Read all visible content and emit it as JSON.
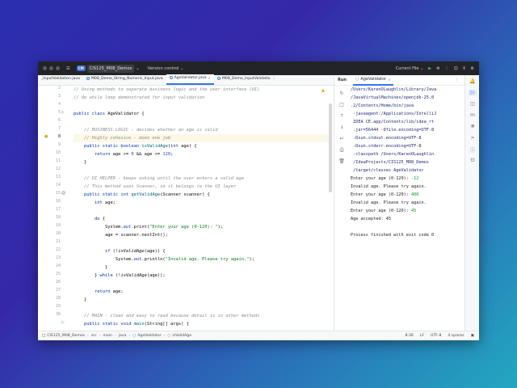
{
  "titlebar": {
    "project_badge": "CM",
    "project_name": "CIS125_M08_Demos",
    "version_control": "Version control",
    "run_config": "Current File"
  },
  "tabs": [
    {
      "label": "_InputValidation.java",
      "active": false
    },
    {
      "label": "M08_Demo_String_Numeric_Input.java",
      "active": false
    },
    {
      "label": "AgeValidator.java",
      "active": true
    },
    {
      "label": "M08_Demo_InputValidatio",
      "active": false
    }
  ],
  "editor": {
    "line_numbers": [
      "2",
      "3",
      "4",
      "5",
      "6",
      "7",
      "8",
      "9",
      "10",
      "11",
      "12",
      "13",
      "14",
      "15",
      "16",
      "17",
      "18",
      "19",
      "20",
      "21",
      "22",
      "23",
      "24",
      "25",
      "26",
      "27",
      "28",
      "29",
      "30"
    ],
    "current_line": "8",
    "lines": {
      "l2": "// Using methods to separate business logic and the user interface (UI)",
      "l3": "// do while loop demonstrated for input validation",
      "l5a": "public class",
      "l5b": " AgeValidator {",
      "l7": "    // BUSINESS LOGIC - decides whether an age is valid",
      "l8": "    // Highly cohesive - does one job",
      "l9a": "    public static boolean ",
      "l9b": "isValidAge",
      "l9c": "(",
      "l9d": "int",
      "l9e": " age) {",
      "l10a": "        return",
      "l10b": " age >= ",
      "l10c": "0",
      "l10d": " && age <= ",
      "l10e": "120",
      "l10f": ";",
      "l11": "    }",
      "l13": "    // UI HELPER - keeps asking until the user enters a valid age",
      "l14": "    // This method uses Scanner, so it belongs to the UI layer",
      "l15a": "    public static int ",
      "l15b": "getValidAge",
      "l15c": "(Scanner scanner) {",
      "l16a": "        int",
      "l16b": " age;",
      "l18a": "        do",
      "l18b": " {",
      "l19a": "            System.",
      "l19b": "out",
      "l19c": ".print(",
      "l19d": "\"Enter your age (0-120): \"",
      "l19e": ");",
      "l20": "            age = scanner.nextInt();",
      "l22a": "            if",
      "l22b": " (!",
      "l22c": "isValidAge",
      "l22d": "(age)) {",
      "l23a": "                System.",
      "l23b": "out",
      "l23c": ".println(",
      "l23d": "\"Invalid age. Please try again.\"",
      "l23e": ");",
      "l24": "            }",
      "l25a": "        } ",
      "l25b": "while",
      "l25c": " (!",
      "l25d": "isValidAge",
      "l25e": "(age));",
      "l27a": "        return",
      "l27b": " age;",
      "l28": "    }",
      "l30": "    // MAIN - clean and easy to read because detail is in other methods",
      "l31a": "    public static void ",
      "l31b": "main",
      "l31c": "(String[] args) {"
    }
  },
  "run": {
    "label": "Run",
    "tab_label": "AgeValidator",
    "console": [
      {
        "text": "/Users/KarenOLaughlin/Library/Java",
        "kind": "path"
      },
      {
        "text": "/JavaVirtualMachines/openjdk-25.0",
        "kind": "path"
      },
      {
        "text": ".2/Contents/Home/bin/java",
        "kind": "path"
      },
      {
        "text": " -javaagent:/Applications/IntelliJ",
        "kind": "path"
      },
      {
        "text": " IDEA CE.app/Contents/lib/idea_rt",
        "kind": "path"
      },
      {
        "text": " .jar=56444 -Dfile.encoding=UTF-8",
        "kind": "path"
      },
      {
        "text": " -Dsun.stdout.encoding=UTF-8",
        "kind": "path"
      },
      {
        "text": " -Dsun.stderr.encoding=UTF-8",
        "kind": "path"
      },
      {
        "text": " -classpath /Users/KarenOLaughlin",
        "kind": "path"
      },
      {
        "text": " /IdeaProjects/CIS125_M08_Demos",
        "kind": "path"
      },
      {
        "text": " /target/classes AgeValidator",
        "kind": "path"
      },
      {
        "text": "Enter your age (0-120): ",
        "input": "-12",
        "kind": "out"
      },
      {
        "text": "Invalid age. Please try again.",
        "kind": "out"
      },
      {
        "text": "Enter your age (0-120): ",
        "input": "400",
        "kind": "out"
      },
      {
        "text": "Invalid age. Please try again.",
        "kind": "out"
      },
      {
        "text": "Enter your age (0-120): ",
        "input": "45",
        "kind": "out"
      },
      {
        "text": "Age accepted: 45",
        "kind": "out"
      },
      {
        "text": "",
        "kind": "out"
      },
      {
        "text": "Process finished with exit code 0",
        "kind": "out"
      }
    ]
  },
  "status": {
    "crumbs": [
      "CIS125_M08_Demos",
      "src",
      "main",
      "java",
      "AgeValidator",
      "isValidAge"
    ],
    "position": "8:36",
    "line_sep": "LF",
    "encoding": "UTF-8",
    "indent": "4 spaces"
  },
  "colors": {
    "keyword": "#0033b3",
    "comment": "#8c8c8c",
    "string": "#067d17",
    "number": "#1750eb",
    "method": "#00627a",
    "accent": "#3574f0"
  }
}
